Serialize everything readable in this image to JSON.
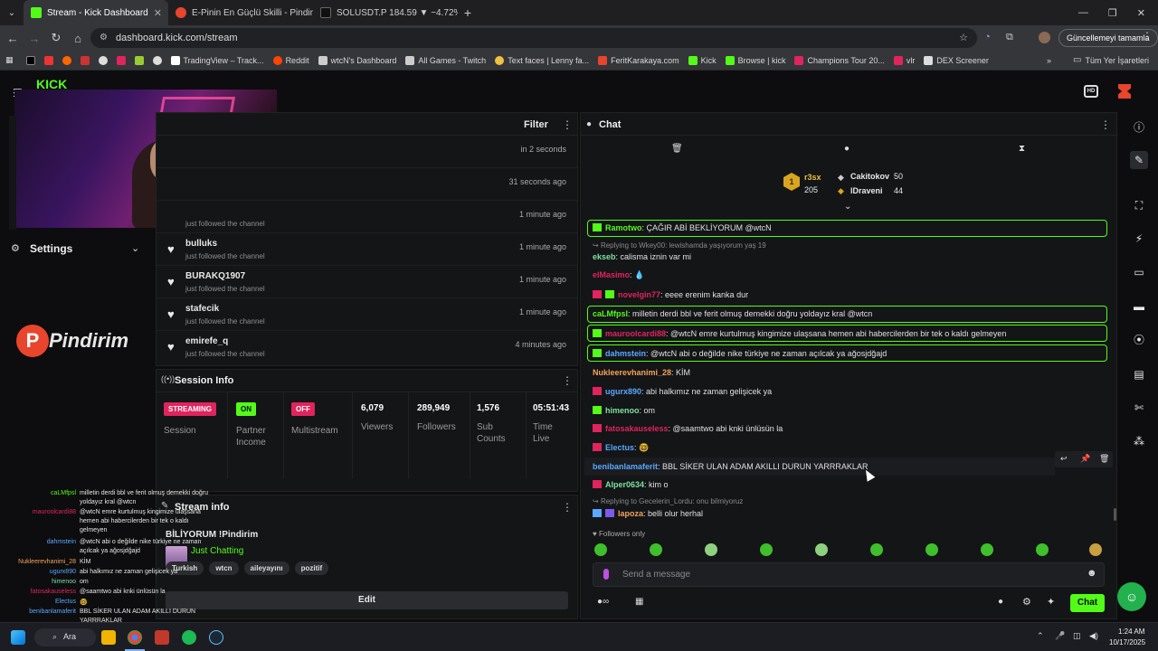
{
  "browser": {
    "tabs": [
      {
        "title": "Stream - Kick Dashboard",
        "active": true,
        "color": "#53fc18"
      },
      {
        "title": "E-Pinin En Güçlü Skilli - Pindirim",
        "active": false,
        "color": "#e8452c"
      },
      {
        "title": "SOLUSDT.P 184.59 ▼ −4.72% U",
        "active": false,
        "color": "#222222"
      }
    ],
    "url": "dashboard.kick.com/stream",
    "update_button": "Güncellemeyi tamamla",
    "bookmarks": [
      "TradingView – Track...",
      "Reddit",
      "wtcN's Dashboard",
      "All Games - Twitch",
      "Text faces | Lenny fa...",
      "FeritKarakaya.com",
      "Kick",
      "Browse | kick",
      "Champions Tour 20...",
      "vlr",
      "DEX Screener"
    ],
    "all_bookmarks": "Tüm Yer İşaretleri"
  },
  "sidebar": {
    "settings_label": "Settings",
    "logo_text": "Pindirim"
  },
  "events": {
    "filter_label": "Filter",
    "items": [
      {
        "name": "",
        "sub": "",
        "time": "in 2 seconds"
      },
      {
        "name": "",
        "sub": "",
        "time": "31 seconds ago"
      },
      {
        "name": "",
        "sub": "just followed the channel",
        "time": "1 minute ago"
      },
      {
        "name": "bulluks",
        "sub": "just followed the channel",
        "time": "1 minute ago"
      },
      {
        "name": "BURAKQ1907",
        "sub": "just followed the channel",
        "time": "1 minute ago"
      },
      {
        "name": "stafecik",
        "sub": "just followed the channel",
        "time": "1 minute ago"
      },
      {
        "name": "emirefe_q",
        "sub": "just followed the channel",
        "time": "4 minutes ago"
      }
    ]
  },
  "session_info": {
    "title": "Session Info",
    "streaming": "STREAMING",
    "session_label": "Session",
    "partner_toggle": "ON",
    "partner_label": "Partner Income",
    "multistream_toggle": "OFF",
    "multistream_label": "Multistream",
    "viewers": "6,079",
    "viewers_label": "Viewers",
    "followers": "289,949",
    "followers_label": "Followers",
    "subs": "1,576",
    "subs_label": "Sub Counts",
    "time": "05:51:43",
    "time_label": "Time Live"
  },
  "stream_info": {
    "title": "Stream info",
    "stream_title": "BİLİYORUM !Pindirim",
    "category": "Just Chatting",
    "tags": [
      "Turkish",
      "wtcn",
      "aileyayını",
      "pozitif"
    ],
    "edit_label": "Edit"
  },
  "chat": {
    "title": "Chat",
    "leaderboard": {
      "first_name": "r3sx",
      "first_value": "205",
      "second_name": "Cakitokov",
      "second_value": "50",
      "third_name": "lDraveni",
      "third_value": "44"
    },
    "messages": [
      {
        "user": "Ramotwo",
        "color": "#53fc18",
        "text": ": ÇAĞIR ABİ BEKLİYORUM @wtcN",
        "highlight": true
      },
      {
        "reply": "Replying to Wkey00: lewishamda yaşıyorum yaş 19"
      },
      {
        "user": "ekseb",
        "color": "#7ee0a0",
        "text": ": calisma iznin var mi"
      },
      {
        "user": "elMasimo",
        "color": "#e0245e",
        "text": ": 💧"
      },
      {
        "user": "novelgin77",
        "color": "#e0245e",
        "text": ": eeee erenim kanka dur"
      },
      {
        "user": "caLMfpsl",
        "color": "#53fc18",
        "text": ": milletin derdi bbl ve ferit olmuş demekki doğru yoldayız kral @wtcn",
        "highlight": true
      },
      {
        "user": "mauroolcardi88",
        "color": "#e0245e",
        "text": ": @wtcN emre kurtulmuş kingimize ulaşsana hemen abi habercilerden bir tek o kaldı gelmeyen",
        "highlight": true
      },
      {
        "user": "dahmstein",
        "color": "#5aa8ff",
        "text": ": @wtcN abi o değilde nike türkiye ne zaman açılcak ya ağosjdğajd",
        "highlight": true
      },
      {
        "user": "Nukleerevhanimi_28",
        "color": "#f5a25a",
        "text": ": KİM"
      },
      {
        "user": "ugurx890",
        "color": "#5aa8ff",
        "text": ": abi halkımız ne zaman gelişicek ya"
      },
      {
        "user": "himenoo",
        "color": "#7ee0a0",
        "text": ": om"
      },
      {
        "user": "fatosakauseless",
        "color": "#e0245e",
        "text": ": @saamtwo abi knki ünlüsün la"
      },
      {
        "user": "Electus",
        "color": "#5aa8ff",
        "text": ": 🤓"
      },
      {
        "user": "benibanlamaferit",
        "color": "#5aa8ff",
        "text": ": BBL SİKER ULAN ADAM AKILLI DURUN YARRRAKLAR"
      },
      {
        "user": "Alper0634",
        "color": "#7ee0a0",
        "text": ": kim o"
      },
      {
        "reply": "Replying to Gecelerin_Lordu: onu bilmiyoruz"
      },
      {
        "user": "lapoza",
        "color": "#f5a25a",
        "text": ": belli olur herhal"
      }
    ],
    "followers_only": "Followers only",
    "input_placeholder": "Send a message",
    "send_label": "Chat"
  },
  "overlay_chat": [
    {
      "user": "caLMfpsl",
      "text": "milletin derdi bbl ve ferit olmuş demekki doğru"
    },
    {
      "user": "",
      "text": "yoldayız kral @wtcn"
    },
    {
      "user": "mauroolcardi88",
      "text": "@wtcN emre kurtulmuş kingimize ulaşsana"
    },
    {
      "user": "",
      "text": "hemen abi habercilerden bir tek o kaldı"
    },
    {
      "user": "",
      "text": "gelmeyen"
    },
    {
      "user": "dahmstein",
      "text": "@wtcN abi o değilde nike türkiye ne zaman"
    },
    {
      "user": "",
      "text": "açılcak ya ağosjdğajd"
    },
    {
      "user": "Nukleerevhanimi_28",
      "text": "KİM"
    },
    {
      "user": "ugurx890",
      "text": "abi halkımız ne zaman gelişicek ya"
    },
    {
      "user": "himenoo",
      "text": "om"
    },
    {
      "user": "fatosakauseless",
      "text": "@saamtwo abi knki ünlüsün la"
    },
    {
      "user": "Electus",
      "text": "🤓"
    },
    {
      "user": "benibanlamaferit",
      "text": "BBL SİKER ULAN ADAM AKILLI DURUN"
    },
    {
      "user": "",
      "text": "YARRRAKLAR"
    },
    {
      "user": "Alper0634",
      "text": "kim o"
    }
  ],
  "taskbar": {
    "search": "Ara",
    "time": "1:24 AM",
    "date": "10/17/2025"
  }
}
